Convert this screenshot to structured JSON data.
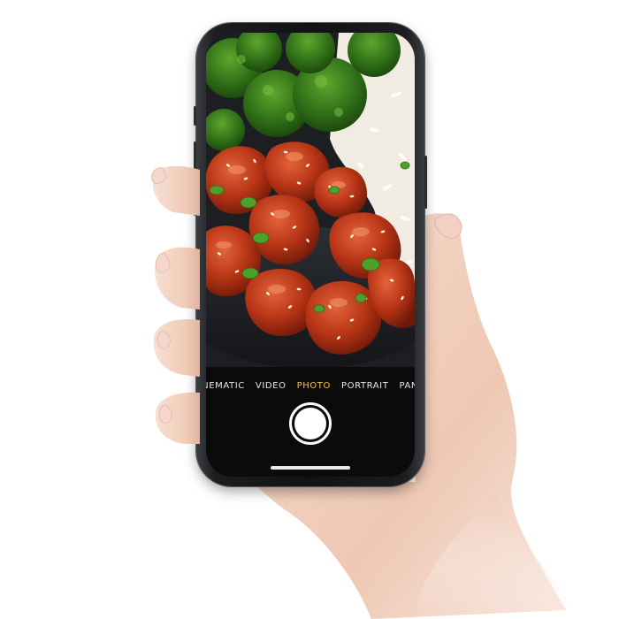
{
  "camera": {
    "modes": [
      "CINEMATIC",
      "VIDEO",
      "PHOTO",
      "PORTRAIT",
      "PANO"
    ],
    "active_mode": "PHOTO"
  },
  "colors": {
    "active_mode": "#f4c644",
    "inactive_mode": "#e8e8e8",
    "controls_background": "#0b0b0b",
    "phone_frame": "#111214"
  },
  "icons": {
    "shutter": "shutter-button-icon"
  }
}
